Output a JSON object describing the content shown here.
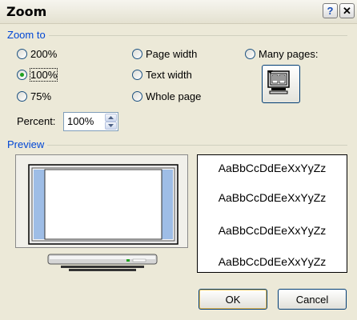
{
  "dialog": {
    "title": "Zoom",
    "help_label": "?",
    "close_label": "✕"
  },
  "zoom_to": {
    "group_label": "Zoom to",
    "options": [
      {
        "label": "200%",
        "selected": false
      },
      {
        "label": "100%",
        "selected": true
      },
      {
        "label": "75%",
        "selected": false
      },
      {
        "label": "Page width",
        "selected": false
      },
      {
        "label": "Text width",
        "selected": false
      },
      {
        "label": "Whole page",
        "selected": false
      },
      {
        "label": "Many pages:",
        "selected": false
      }
    ],
    "many_pages_icon": "many-pages-monitor-icon"
  },
  "percent": {
    "label": "Percent:",
    "value": "100%"
  },
  "preview": {
    "group_label": "Preview",
    "sample_lines": [
      "AaBbCcDdEeXxYyZz",
      "AaBbCcDdEeXxYyZz",
      "AaBbCcDdEeXxYyZz",
      "AaBbCcDdEeXxYyZz"
    ]
  },
  "buttons": {
    "ok": "OK",
    "cancel": "Cancel"
  },
  "colors": {
    "group_label": "#0046d5",
    "dialog_bg": "#ece9d8",
    "radio_dot": "#21a121",
    "monitor_side": "#9ebde6"
  }
}
